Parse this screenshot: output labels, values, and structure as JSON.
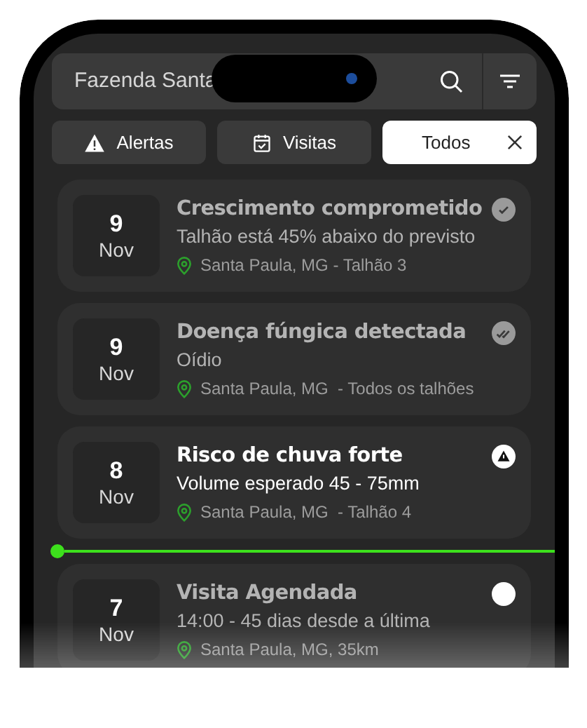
{
  "search": {
    "value": "Fazenda Santa"
  },
  "filters": [
    {
      "kind": "alerts",
      "label": "Alertas",
      "selected": false
    },
    {
      "kind": "visits",
      "label": "Visitas",
      "selected": false
    },
    {
      "kind": "all",
      "label": "Todos",
      "selected": true
    }
  ],
  "timeline": [
    {
      "kind": "read_event",
      "day": "9",
      "month": "Nov",
      "title": "Crescimento comprometido",
      "subtitle": "Talhão está 45% abaixo do previsto",
      "location": "Santa Paula, MG - Talhão 3",
      "dimmed": true
    },
    {
      "kind": "seen_event",
      "day": "9",
      "month": "Nov",
      "title": "Doença fúngica detectada",
      "subtitle": "Oídio",
      "location": "Santa Paula, MG  - Todos os talhões",
      "dimmed": true
    },
    {
      "kind": "alert_event",
      "day": "8",
      "month": "Nov",
      "title": "Risco de chuva forte",
      "subtitle": "Volume esperado 45 - 75mm",
      "location": "Santa Paula, MG  - Talhão 4",
      "dimmed": false
    },
    {
      "kind": "now_marker"
    },
    {
      "kind": "pending_event",
      "day": "7",
      "month": "Nov",
      "title": "Visita Agendada",
      "subtitle": "14:00 - 45 dias desde a última",
      "location": "Santa Paula, MG, 35km",
      "dimmed": true
    }
  ]
}
